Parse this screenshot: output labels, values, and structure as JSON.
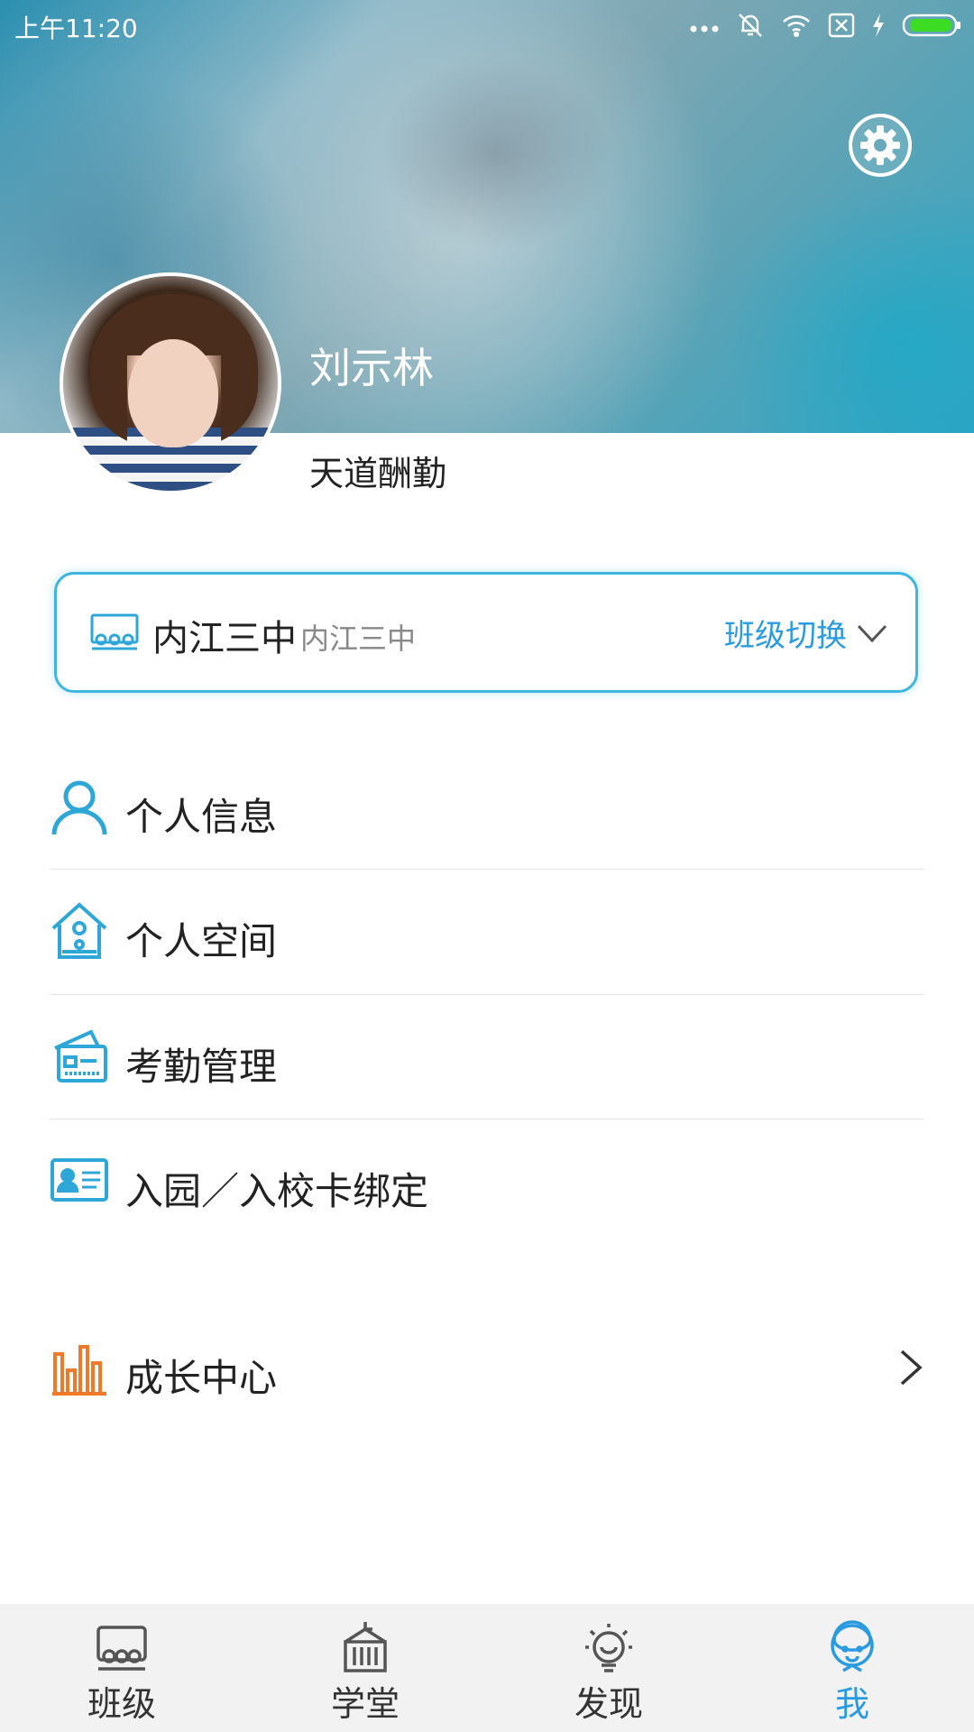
{
  "status_bar": {
    "time": "上午11:20"
  },
  "profile": {
    "name": "刘示林",
    "subtitle": "天道酬勤"
  },
  "class_card": {
    "school_primary": "内江三中",
    "school_secondary": "内江三中",
    "switch_label": "班级切换"
  },
  "menu": {
    "items": [
      {
        "label": "个人信息",
        "icon": "person-icon"
      },
      {
        "label": "个人空间",
        "icon": "house-icon"
      },
      {
        "label": "考勤管理",
        "icon": "attendance-card-icon"
      },
      {
        "label": "入园／入校卡绑定",
        "icon": "id-card-icon"
      }
    ],
    "growth": {
      "label": "成长中心",
      "icon": "bar-chart-icon"
    }
  },
  "tabs": [
    {
      "label": "班级",
      "icon": "classroom-icon",
      "active": false
    },
    {
      "label": "学堂",
      "icon": "school-building-icon",
      "active": false
    },
    {
      "label": "发现",
      "icon": "lightbulb-icon",
      "active": false
    },
    {
      "label": "我",
      "icon": "user-face-icon",
      "active": true
    }
  ],
  "colors": {
    "accent": "#2a9be0",
    "card_border": "#3fb6e0",
    "growth_icon": "#f07a2a"
  }
}
